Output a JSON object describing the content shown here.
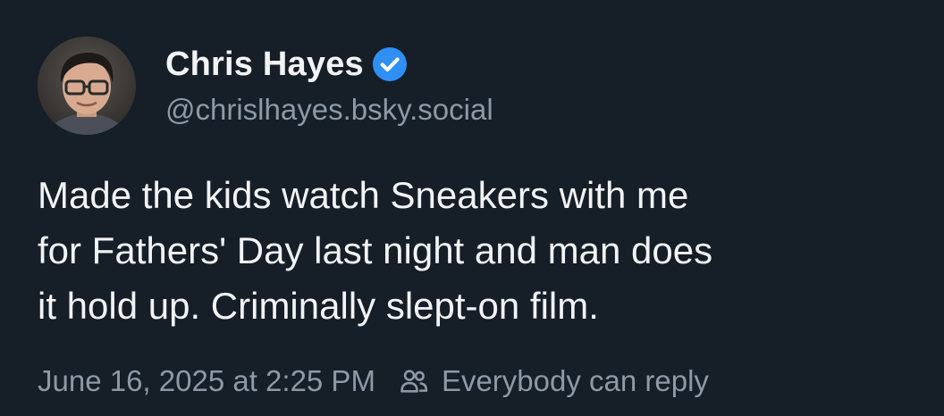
{
  "post": {
    "author": {
      "display_name": "Chris Hayes",
      "handle": "@chrislhayes.bsky.social",
      "verified_icon": "verified-check-icon",
      "avatar": "avatar-photo"
    },
    "text_lines": [
      "Made the kids watch Sneakers with me",
      "for Fathers' Day last night and man does",
      "it hold up. Criminally slept-on film."
    ],
    "timestamp": "June 16, 2025 at 2:25 PM",
    "reply_setting": {
      "icon": "people-icon",
      "label": "Everybody can reply"
    }
  },
  "colors": {
    "background": "#161e27",
    "text": "#f1f3f5",
    "muted": "#8d99a6",
    "verified": "#2f8ff5"
  }
}
